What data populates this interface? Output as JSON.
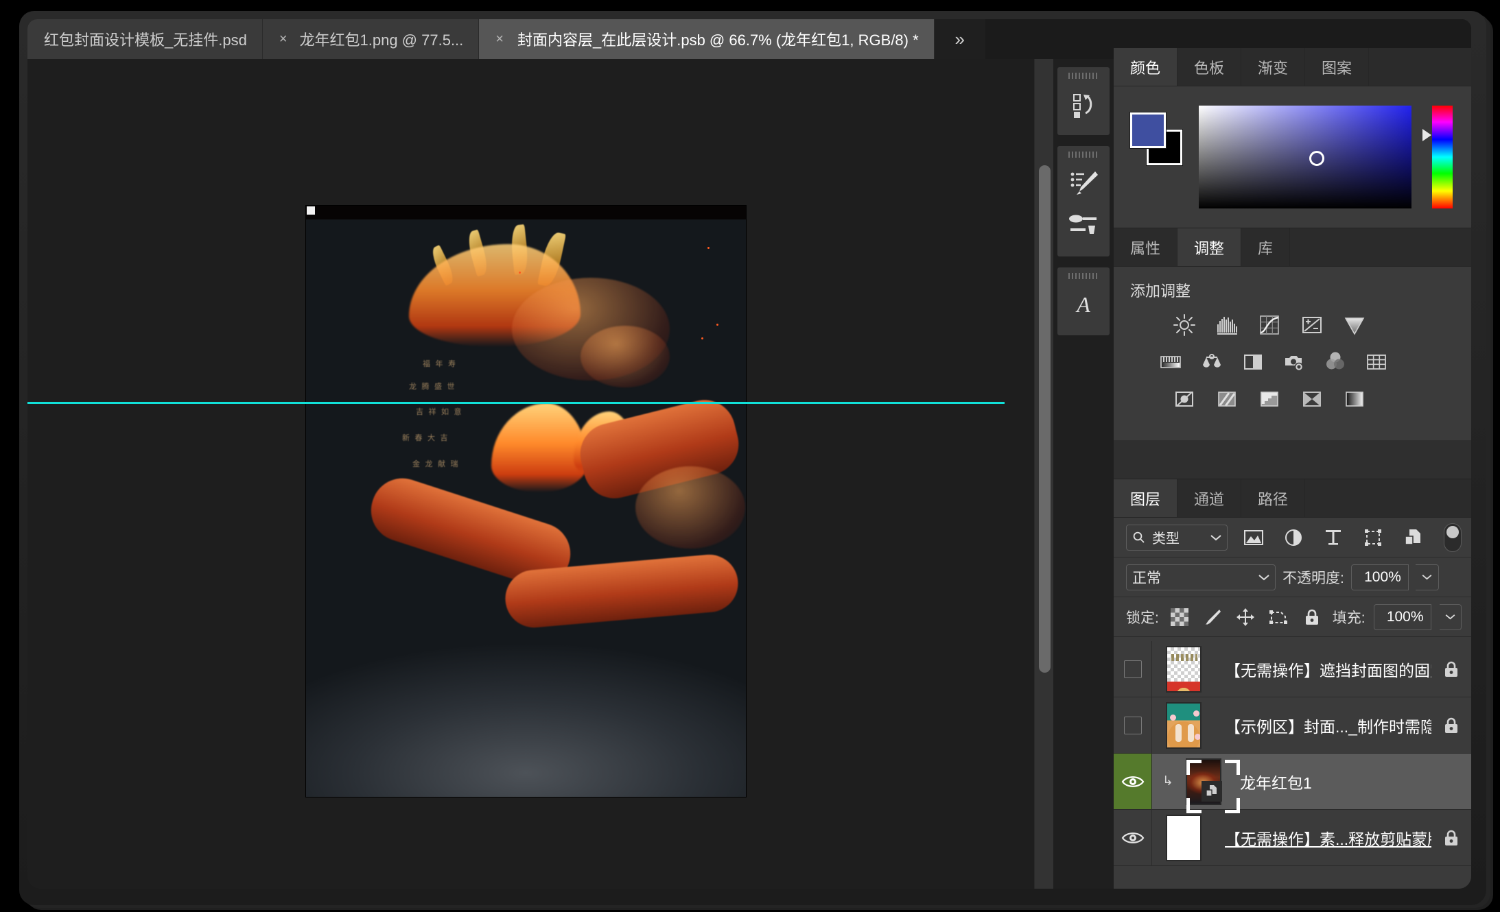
{
  "app": {
    "name": "Adobe Photoshop"
  },
  "tabs": {
    "items": [
      {
        "label": "红包封面设计模板_无挂件.psd",
        "active": false,
        "closable": false
      },
      {
        "label": "龙年红包1.png @ 77.5...",
        "active": false,
        "closable": true
      },
      {
        "label": "封面内容层_在此层设计.psb @ 66.7% (龙年红包1, RGB/8) *",
        "active": true,
        "closable": true
      }
    ],
    "overflow_label": "»",
    "close_glyph": "×"
  },
  "canvas": {
    "zoom_label": "66.7%",
    "guide_color": "#11e0d8",
    "artwork_alt": "红色中国龙与水晶球",
    "orb_texts": [
      "福 年 寿",
      "龙 腾 盛 世",
      "吉 祥 如 意",
      "新 春 大 吉",
      "金 龙 献 瑞"
    ]
  },
  "dock_icons": {
    "items": [
      {
        "name": "history-icon",
        "tooltip": "历史记录"
      },
      {
        "name": "brush-settings-icon",
        "tooltip": "画笔设置"
      },
      {
        "name": "brushes-icon",
        "tooltip": "画笔"
      },
      {
        "name": "character-icon",
        "tooltip": "字符"
      }
    ]
  },
  "color_panel": {
    "tabs": [
      {
        "label": "颜色",
        "active": true
      },
      {
        "label": "色板",
        "active": false
      },
      {
        "label": "渐变",
        "active": false
      },
      {
        "label": "图案",
        "active": false
      }
    ],
    "foreground_color": "#3f4fa0",
    "background_color": "#000000"
  },
  "adjust_panel": {
    "tabs": [
      {
        "label": "属性",
        "active": false
      },
      {
        "label": "调整",
        "active": true
      },
      {
        "label": "库",
        "active": false
      }
    ],
    "title": "添加调整",
    "rows": [
      [
        {
          "name": "brightness-contrast-icon",
          "label": "亮度/对比度"
        },
        {
          "name": "levels-icon",
          "label": "色阶"
        },
        {
          "name": "curves-icon",
          "label": "曲线"
        },
        {
          "name": "exposure-icon",
          "label": "曝光度"
        },
        {
          "name": "vibrance-icon",
          "label": "自然饱和度"
        }
      ],
      [
        {
          "name": "hue-saturation-icon",
          "label": "色相/饱和度"
        },
        {
          "name": "color-balance-icon",
          "label": "色彩平衡"
        },
        {
          "name": "black-white-icon",
          "label": "黑白"
        },
        {
          "name": "photo-filter-icon",
          "label": "照片滤镜"
        },
        {
          "name": "channel-mixer-icon",
          "label": "通道混合器"
        },
        {
          "name": "color-lookup-icon",
          "label": "颜色查找"
        }
      ],
      [
        {
          "name": "invert-icon",
          "label": "反相"
        },
        {
          "name": "posterize-icon",
          "label": "色调分离"
        },
        {
          "name": "threshold-icon",
          "label": "阈值"
        },
        {
          "name": "selective-color-icon",
          "label": "可选颜色"
        },
        {
          "name": "gradient-map-icon",
          "label": "渐变映射"
        }
      ]
    ]
  },
  "layers_panel": {
    "tabs": [
      {
        "label": "图层",
        "active": true
      },
      {
        "label": "通道",
        "active": false
      },
      {
        "label": "路径",
        "active": false
      }
    ],
    "filter": {
      "type_label": "类型",
      "icons": [
        {
          "name": "filter-pixel-icon",
          "label": "像素图层"
        },
        {
          "name": "filter-adjustment-icon",
          "label": "调整图层"
        },
        {
          "name": "filter-type-icon",
          "label": "文字图层"
        },
        {
          "name": "filter-shape-icon",
          "label": "形状图层"
        },
        {
          "name": "filter-smart-object-icon",
          "label": "智能对象"
        }
      ],
      "toggle_on": false
    },
    "blend": {
      "mode": "正常",
      "opacity_label": "不透明度:",
      "opacity_value": "100%"
    },
    "lock": {
      "label": "锁定:",
      "icons": [
        {
          "name": "lock-transparency-icon",
          "label": "锁定透明像素"
        },
        {
          "name": "lock-image-icon",
          "label": "锁定图像像素"
        },
        {
          "name": "lock-position-icon",
          "label": "锁定位置"
        },
        {
          "name": "lock-artboard-icon",
          "label": "防止在画板内外自动嵌套"
        },
        {
          "name": "lock-all-icon",
          "label": "锁定全部"
        }
      ],
      "fill_label": "填充:",
      "fill_value": "100%"
    },
    "layers": [
      {
        "name": "【无需操作】遮挡封面图的固定元素",
        "visible": false,
        "locked": true,
        "selected": false,
        "clipped": false,
        "underline": false,
        "thumb": "checker"
      },
      {
        "name": "【示例区】封面..._制作时需隐藏",
        "visible": false,
        "locked": true,
        "selected": false,
        "clipped": false,
        "underline": false,
        "thumb": "illus"
      },
      {
        "name": "龙年红包1",
        "visible": true,
        "locked": false,
        "selected": true,
        "clipped": true,
        "underline": false,
        "thumb": "dragon"
      },
      {
        "name": "【无需操作】素...释放剪贴蒙版",
        "visible": true,
        "locked": true,
        "selected": false,
        "clipped": false,
        "underline": true,
        "thumb": "white"
      }
    ]
  }
}
